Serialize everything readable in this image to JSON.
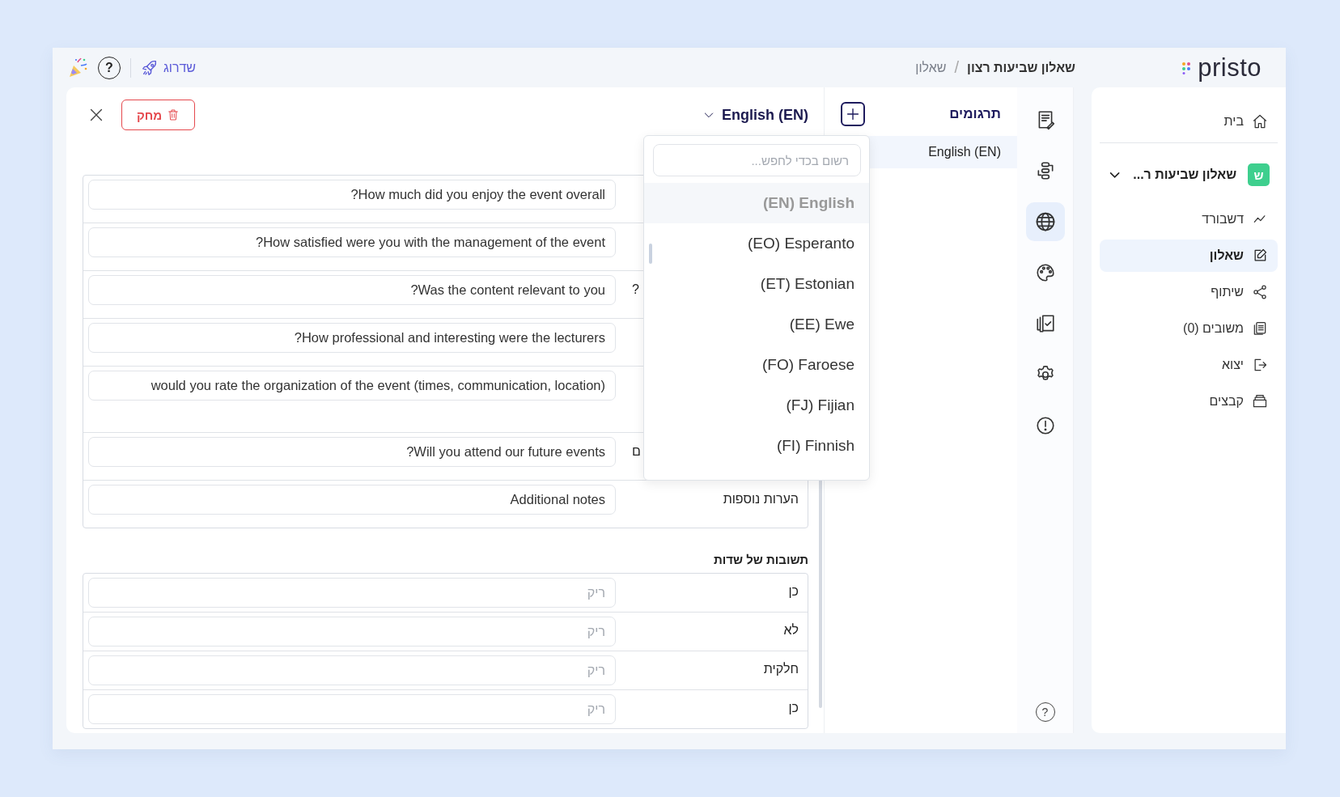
{
  "header": {
    "logo": "pristo",
    "breadcrumb": {
      "items": [
        {
          "label": "שאלון שביעות רצון",
          "current": true
        },
        {
          "label": "שאלון",
          "current": false
        }
      ],
      "separator": "/"
    },
    "upgrade": "שדרוג",
    "help": "?"
  },
  "nav": {
    "home": "בית",
    "project": {
      "badge": "ש",
      "name": "שאלון שביעות ר...",
      "expanded": true
    },
    "items": [
      {
        "label": "דשבורד",
        "selected": false
      },
      {
        "label": "שאלון",
        "selected": true
      },
      {
        "label": "שיתוף",
        "selected": false
      },
      {
        "label": "משובים (0)",
        "selected": false
      },
      {
        "label": "יצוא",
        "selected": false
      },
      {
        "label": "קבצים",
        "selected": false
      }
    ]
  },
  "rail": {
    "items": [
      {
        "selected": false
      },
      {
        "selected": false
      },
      {
        "selected": true
      },
      {
        "selected": false
      },
      {
        "selected": false
      },
      {
        "selected": false
      },
      {
        "selected": false
      }
    ],
    "help": "?"
  },
  "translations": {
    "title": "תרגומים",
    "languages": [
      {
        "label": "English (EN)",
        "selected": true
      }
    ]
  },
  "editor": {
    "language": "English (EN)",
    "delete": "מחק",
    "questions": [
      {
        "value": "?How much did you enjoy the event overall"
      },
      {
        "value": "?How satisfied were you with the management of the event"
      },
      {
        "label": "?",
        "label_clipped": true,
        "value": "?Was the content relevant to you"
      },
      {
        "value": "?How professional and interesting were the lecturers"
      },
      {
        "value": "would you rate the organization of the event (times, communication, location)",
        "tall": true
      },
      {
        "label": "ם",
        "label_clipped": true,
        "value": "?Will you attend our future events"
      },
      {
        "label": "הערות נוספות",
        "label_clipped": false,
        "value": "Additional notes"
      }
    ],
    "answers": {
      "title": "תשובות של שדות",
      "rows": [
        {
          "label": "כן",
          "placeholder": "ריק"
        },
        {
          "label": "לא",
          "placeholder": "ריק"
        },
        {
          "label": "חלקית",
          "placeholder": "ריק"
        },
        {
          "label": "כן",
          "placeholder": "ריק"
        }
      ]
    }
  },
  "dropdown": {
    "search_placeholder": "רשום בכדי לחפש...",
    "options": [
      {
        "label": "(EN) English",
        "selected": true
      },
      {
        "label": "(EO) Esperanto",
        "selected": false
      },
      {
        "label": "(ET) Estonian",
        "selected": false
      },
      {
        "label": "(EE) Ewe",
        "selected": false
      },
      {
        "label": "(FO) Faroese",
        "selected": false
      },
      {
        "label": "(FJ) Fijian",
        "selected": false
      },
      {
        "label": "(FI) Finnish",
        "selected": false
      }
    ]
  }
}
